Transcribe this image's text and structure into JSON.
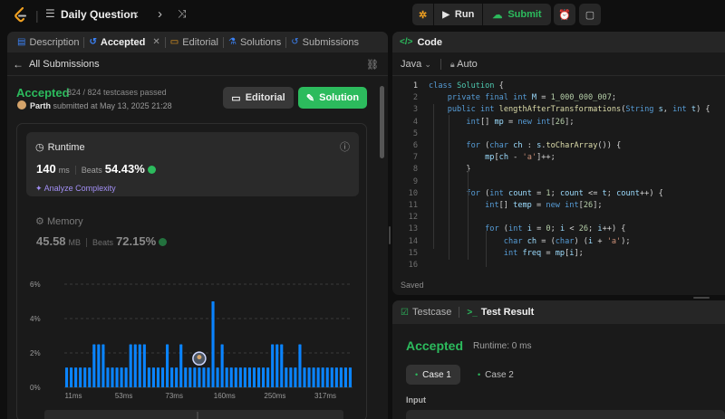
{
  "topbar": {
    "title": "Daily Question",
    "run_label": "Run",
    "submit_label": "Submit"
  },
  "left_tabs": [
    {
      "label": "Description"
    },
    {
      "label": "Accepted",
      "close": "✕"
    },
    {
      "label": "Editorial"
    },
    {
      "label": "Solutions"
    },
    {
      "label": "Submissions"
    }
  ],
  "submission": {
    "back_label": "All Submissions",
    "status": "Accepted",
    "testcases": "824 / 824 testcases passed",
    "user": "Parth",
    "submitted_text": "submitted at May 13, 2025 21:28",
    "editorial_btn": "Editorial",
    "solution_btn": "Solution"
  },
  "runtime": {
    "label": "Runtime",
    "value": "140",
    "unit": "ms",
    "beats_label": "Beats",
    "beats_value": "54.43%",
    "analyze": "Analyze Complexity"
  },
  "memory": {
    "label": "Memory",
    "value": "45.58",
    "unit": "MB",
    "beats_label": "Beats",
    "beats_value": "72.15%"
  },
  "chart_data": {
    "type": "bar",
    "y_ticks": [
      "6%",
      "4%",
      "2%",
      "0%"
    ],
    "ylim": [
      0,
      6
    ],
    "x_tick_labels": [
      "11ms",
      "53ms",
      "73ms",
      "160ms",
      "250ms",
      "317ms"
    ],
    "values": [
      1.15,
      1.15,
      1.15,
      1.15,
      1.15,
      1.15,
      2.5,
      2.5,
      2.5,
      1.15,
      1.15,
      1.15,
      1.15,
      1.15,
      2.5,
      2.5,
      2.5,
      2.5,
      1.15,
      1.15,
      1.15,
      1.15,
      2.5,
      1.15,
      1.15,
      2.5,
      1.15,
      1.15,
      1.15,
      1.15,
      1.15,
      1.15,
      5.0,
      1.15,
      2.5,
      1.15,
      1.15,
      1.15,
      1.15,
      1.15,
      1.15,
      1.15,
      1.15,
      1.15,
      1.15,
      2.5,
      2.5,
      2.5,
      1.15,
      1.15,
      1.15,
      2.5,
      1.15,
      1.15,
      1.15,
      1.15,
      1.15,
      1.15,
      1.15,
      1.15,
      1.15,
      1.15,
      1.15
    ],
    "highlight_index": 29,
    "bar_color": "#0a84ff"
  },
  "code": {
    "tab_label": "Code",
    "language": "Java",
    "mode": "Auto",
    "saved": "Saved",
    "lines": [
      "class Solution {",
      "    private final int M = 1_000_000_007;",
      "    public int lengthAfterTransformations(String s, int t) {",
      "        int[] mp = new int[26];",
      "",
      "        for (char ch : s.toCharArray()) {",
      "            mp[ch - 'a']++;",
      "        }",
      "",
      "        for (int count = 1; count <= t; count++) {",
      "            int[] temp = new int[26];",
      "",
      "            for (int i = 0; i < 26; i++) {",
      "                char ch = (char) (i + 'a');",
      "                int freq = mp[i];",
      ""
    ]
  },
  "test": {
    "tab_testcase": "Testcase",
    "tab_result": "Test Result",
    "status": "Accepted",
    "runtime": "Runtime: 0 ms",
    "case1": "Case 1",
    "case2": "Case 2",
    "input_label": "Input"
  },
  "colors": {
    "accent_green": "#2cbb5d",
    "accent_blue": "#0a84ff",
    "accent_purple": "#a28ff5"
  }
}
